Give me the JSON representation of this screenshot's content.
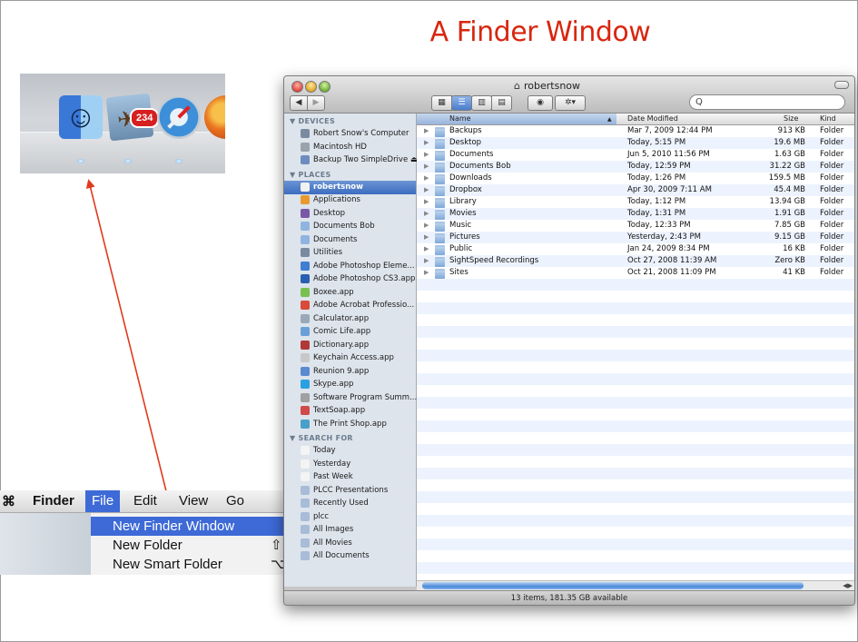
{
  "slide": {
    "title": "A Finder Window"
  },
  "dock": {
    "badge": "234",
    "items": [
      "finder-icon",
      "iphoto-icon",
      "safari-icon",
      "firefox-icon"
    ]
  },
  "menubar": {
    "items": [
      "Finder",
      "File",
      "Edit",
      "View",
      "Go"
    ],
    "file_menu": [
      {
        "label": "New Finder Window",
        "shortcut": "",
        "highlighted": true
      },
      {
        "label": "New Folder",
        "shortcut": "⇧"
      },
      {
        "label": "New Smart Folder",
        "shortcut": "⌥"
      }
    ]
  },
  "window": {
    "title": "robertsnow",
    "search_placeholder": "",
    "sidebar": {
      "devices_header": "▼ DEVICES",
      "devices": [
        "Robert Snow's Computer",
        "Macintosh HD",
        "Backup Two SimpleDrive ⏏"
      ],
      "places_header": "▼ PLACES",
      "places": [
        "robertsnow",
        "Applications",
        "Desktop",
        "Documents Bob",
        "Documents",
        "Utilities",
        "Adobe Photoshop Eleme...",
        "Adobe Photoshop CS3.app",
        "Boxee.app",
        "Adobe Acrobat Professio...",
        "Calculator.app",
        "Comic Life.app",
        "Dictionary.app",
        "Keychain Access.app",
        "Reunion 9.app",
        "Skype.app",
        "Software Program Summ...",
        "TextSoap.app",
        "The Print Shop.app"
      ],
      "search_header": "▼ SEARCH FOR",
      "searches": [
        "Today",
        "Yesterday",
        "Past Week",
        "PLCC Presentations",
        "Recently Used",
        "plcc",
        "All Images",
        "All Movies",
        "All Documents"
      ]
    },
    "columns": {
      "name": "Name",
      "date": "Date Modified",
      "size": "Size",
      "kind": "Kind"
    },
    "rows": [
      {
        "name": "Backups",
        "date": "Mar 7, 2009 12:44 PM",
        "size": "913 KB",
        "kind": "Folder"
      },
      {
        "name": "Desktop",
        "date": "Today, 5:15 PM",
        "size": "19.6 MB",
        "kind": "Folder"
      },
      {
        "name": "Documents",
        "date": "Jun 5, 2010 11:56 PM",
        "size": "1.63 GB",
        "kind": "Folder"
      },
      {
        "name": "Documents Bob",
        "date": "Today, 12:59 PM",
        "size": "31.22 GB",
        "kind": "Folder"
      },
      {
        "name": "Downloads",
        "date": "Today, 1:26 PM",
        "size": "159.5 MB",
        "kind": "Folder"
      },
      {
        "name": "Dropbox",
        "date": "Apr 30, 2009 7:11 AM",
        "size": "45.4 MB",
        "kind": "Folder"
      },
      {
        "name": "Library",
        "date": "Today, 1:12 PM",
        "size": "13.94 GB",
        "kind": "Folder"
      },
      {
        "name": "Movies",
        "date": "Today, 1:31 PM",
        "size": "1.91 GB",
        "kind": "Folder"
      },
      {
        "name": "Music",
        "date": "Today, 12:33 PM",
        "size": "7.85 GB",
        "kind": "Folder"
      },
      {
        "name": "Pictures",
        "date": "Yesterday, 2:43 PM",
        "size": "9.15 GB",
        "kind": "Folder"
      },
      {
        "name": "Public",
        "date": "Jan 24, 2009 8:34 PM",
        "size": "16 KB",
        "kind": "Folder"
      },
      {
        "name": "SightSpeed Recordings",
        "date": "Oct 27, 2008 11:39 AM",
        "size": "Zero KB",
        "kind": "Folder"
      },
      {
        "name": "Sites",
        "date": "Oct 21, 2008 11:09 PM",
        "size": "41 KB",
        "kind": "Folder"
      }
    ],
    "status": "13 items, 181.35 GB available"
  },
  "colors": {
    "title": "#d8260f",
    "arrow": "#e03a1e",
    "selection": "#3d6ad6"
  }
}
